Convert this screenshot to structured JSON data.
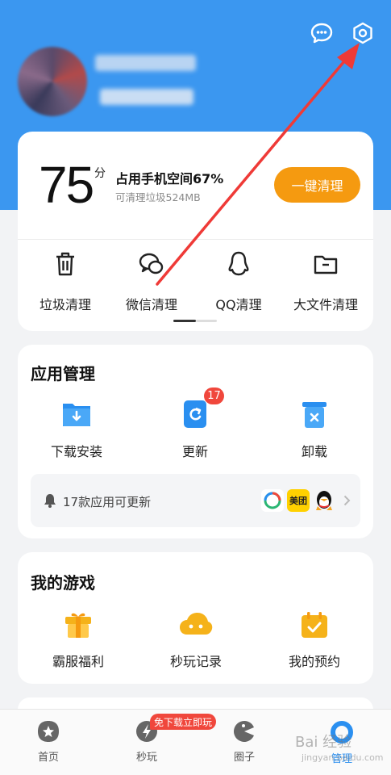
{
  "header": {
    "message_icon": "chat-bubble-icon",
    "settings_icon": "hexagon-settings-icon"
  },
  "cleaner": {
    "score": "75",
    "score_unit": "分",
    "usage_title": "占用手机空间67%",
    "usage_sub": "可清理垃圾524MB",
    "clean_button": "一键清理",
    "tools": [
      {
        "label": "垃圾清理",
        "icon": "trash-icon"
      },
      {
        "label": "微信清理",
        "icon": "wechat-icon"
      },
      {
        "label": "QQ清理",
        "icon": "qq-icon"
      },
      {
        "label": "大文件清理",
        "icon": "folder-icon"
      }
    ]
  },
  "app_manage": {
    "title": "应用管理",
    "items": [
      {
        "label": "下载安装",
        "icon": "download-folder-icon"
      },
      {
        "label": "更新",
        "icon": "update-icon"
      },
      {
        "label": "卸载",
        "icon": "uninstall-icon"
      }
    ],
    "update_badge": "17",
    "update_notice": "17款应用可更新",
    "meituan_label": "美团"
  },
  "games": {
    "title": "我的游戏",
    "items": [
      {
        "label": "霸服福利",
        "icon": "gift-icon"
      },
      {
        "label": "秒玩记录",
        "icon": "gamepad-cloud-icon"
      },
      {
        "label": "我的预约",
        "icon": "calendar-check-icon"
      }
    ]
  },
  "bottom_nav": {
    "items": [
      {
        "label": "首页",
        "icon": "home-star-icon"
      },
      {
        "label": "秒玩",
        "icon": "lightning-icon"
      },
      {
        "label": "圈子",
        "icon": "pacman-icon"
      },
      {
        "label": "管理",
        "icon": "manage-ring-icon"
      }
    ],
    "promo": "免下载立即玩",
    "active": "管理"
  },
  "watermark": {
    "text": "Bai 经验",
    "sub": "jingyan.baidu.com"
  },
  "colors": {
    "brand_blue": "#3b97f0",
    "accent_orange": "#f59a10",
    "badge_red": "#f0473c",
    "annotation_red": "#ef3a37"
  }
}
